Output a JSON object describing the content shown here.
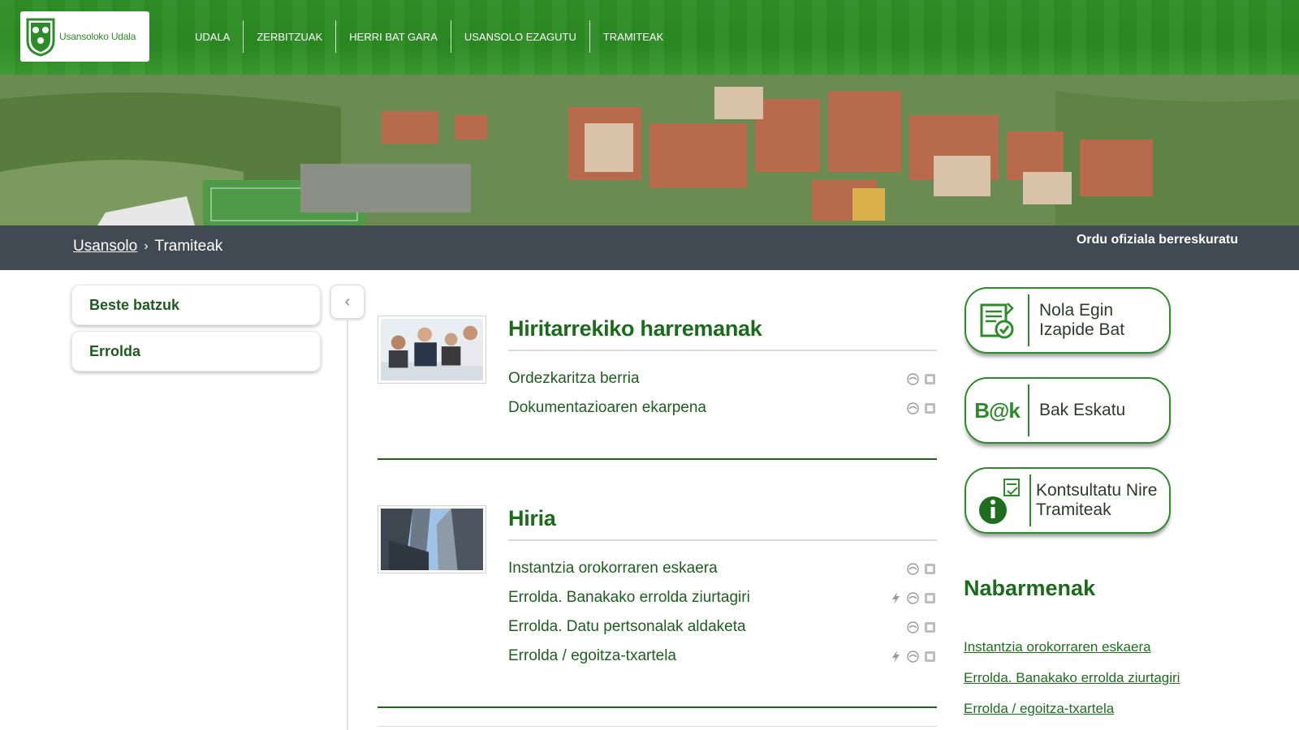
{
  "header": {
    "logo_text": "Usansoloko Udala",
    "nav": [
      "UDALA",
      "ZERBITZUAK",
      "HERRI BAT GARA",
      "USANSOLO EZAGUTU",
      "TRAMITEAK"
    ]
  },
  "breadcrumb": {
    "home": "Usansolo",
    "separator": "›",
    "current": "Tramiteak",
    "recover": "Ordu ofiziala berreskuratu"
  },
  "sidebar": {
    "items": [
      "Beste batzuk",
      "Errolda"
    ],
    "collapse_glyph": "‹"
  },
  "sections": [
    {
      "title": "Hiritarrekiko harremanak",
      "items": [
        {
          "label": "Ordezkaritza berria",
          "icons": [
            "online-icon",
            "inperson-icon"
          ]
        },
        {
          "label": "Dokumentazioaren ekarpena",
          "icons": [
            "online-icon",
            "inperson-icon"
          ]
        }
      ]
    },
    {
      "title": "Hiria",
      "items": [
        {
          "label": "Instantzia orokorraren eskaera",
          "icons": [
            "online-icon",
            "inperson-icon"
          ]
        },
        {
          "label": "Errolda. Banakako errolda ziurtagiri",
          "icons": [
            "instant-icon",
            "online-icon",
            "inperson-icon"
          ]
        },
        {
          "label": "Errolda. Datu pertsonalak aldaketa",
          "icons": [
            "online-icon",
            "inperson-icon"
          ]
        },
        {
          "label": "Errolda / egoitza-txartela",
          "icons": [
            "instant-icon",
            "online-icon",
            "inperson-icon"
          ]
        }
      ]
    }
  ],
  "actions": [
    {
      "line1": "Nola Egin",
      "line2": "Izapide Bat",
      "icon": "document-check-icon"
    },
    {
      "line1": "Bak Eskatu",
      "line2": "",
      "icon": "bak-logo-icon",
      "icon_text": "B@k"
    },
    {
      "line1": "Kontsultatu Nire",
      "line2": "Tramiteak",
      "icon": "info-icon"
    }
  ],
  "nabarmenak": {
    "title": "Nabarmenak",
    "links": [
      "Instantzia orokorraren eskaera",
      "Errolda. Banakako errolda ziurtagiri",
      "Errolda / egoitza-txartela"
    ]
  },
  "colors": {
    "brand_green": "#2e8b2a",
    "heading_green": "#1c6b1c",
    "breadcrumb_bar": "#414a52"
  }
}
